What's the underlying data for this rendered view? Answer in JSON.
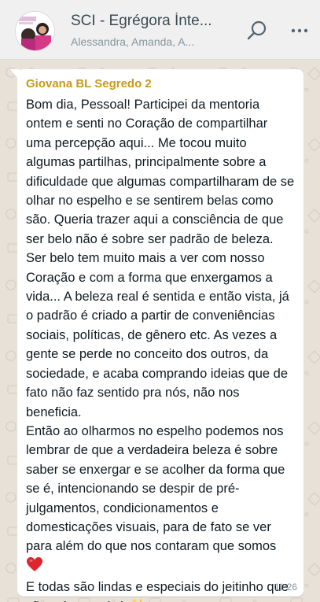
{
  "header": {
    "title": "SCI - Egrégora Ínte...",
    "subtitle": "Alessandra, Amanda, A..."
  },
  "colors": {
    "header_bg": "#f0f0f0",
    "chat_bg": "#e8e1d8",
    "bubble_bg": "#ffffff",
    "sender_color": "#c79a1a"
  },
  "message": {
    "sender": "Giovana BL Segredo 2",
    "paragraph_1": "Bom dia, Pessoal! Participei da mentoria ontem e senti no Coração de compartilhar uma percepção aqui... Me tocou muito algumas partilhas, principalmente sobre a dificuldade que algumas compartilharam de se olhar no espelho e se sentirem belas como são. Queria trazer aqui a consciência de que ser belo não é sobre ser padrão de beleza. Ser belo tem muito mais a ver com nosso Coração e com a forma que enxergamos a vida... A beleza real é sentida e então vista, já o padrão é criado a partir de conveniências sociais, políticas, de gênero etc. As vezes a gente se perde no conceito dos outros, da sociedade, e acaba comprando ideias que de fato não faz sentido pra nós, não nos beneficia.",
    "paragraph_2": "Então ao olharmos no espelho podemos nos lembrar de que a verdadeira beleza é sobre saber se enxergar e se acolher da forma que se é, intencionando se despir de pré-julgamentos, condicionamentos e domesticações visuais, para de fato se ver para além do que nos contaram que somos",
    "paragraph_3": "E todas são lindas e especiais do jeitinho que são, só por existir",
    "time": "11:26"
  },
  "icons": {
    "search": "search-icon",
    "menu": "more-vertical-icon",
    "heart": "red-heart-emoji",
    "sparkles": "sparkles-emoji"
  }
}
